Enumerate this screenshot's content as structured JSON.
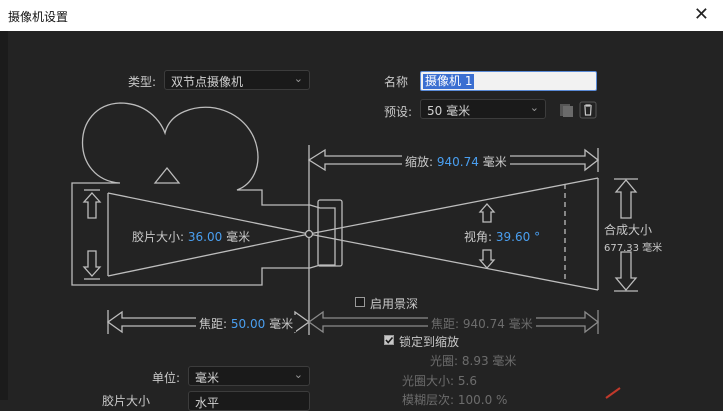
{
  "window": {
    "title": "摄像机设置"
  },
  "type": {
    "label": "类型:",
    "value": "双节点摄像机"
  },
  "name": {
    "label": "名称",
    "value": "摄像机 1"
  },
  "preset": {
    "label": "预设:",
    "value": "50 毫米"
  },
  "diagram": {
    "zoom_label": "缩放:",
    "zoom_value": "940.74",
    "zoom_unit": "毫米",
    "film_label": "胶片大小:",
    "film_value": "36.00",
    "film_unit": "毫米",
    "angle_label": "视角:",
    "angle_value": "39.60",
    "angle_unit": "°",
    "comp_label": "合成大小",
    "comp_value": "677.33 毫米",
    "focal_label": "焦距:",
    "focal_value": "50.00",
    "focal_unit": "毫米",
    "focus_dist_label": "焦距:",
    "focus_dist_value": "940.74",
    "focus_dist_unit": "毫米"
  },
  "depth_of_field": {
    "label": "启用景深",
    "checked": false
  },
  "lock_zoom": {
    "label": "锁定到缩放",
    "checked": true
  },
  "aperture": {
    "label": "光圈:",
    "value": "8.93",
    "unit": "毫米"
  },
  "fstop": {
    "label": "光圈大小:",
    "value": "5.6"
  },
  "blur": {
    "label": "模糊层次:",
    "value": "100.0 %"
  },
  "units": {
    "label": "单位:",
    "value": "毫米"
  },
  "film_measure": {
    "label": "胶片大小",
    "value": "水平"
  },
  "colors": {
    "bg": "#232323",
    "accent": "#4a9ff0",
    "line": "#bdbdbd"
  }
}
